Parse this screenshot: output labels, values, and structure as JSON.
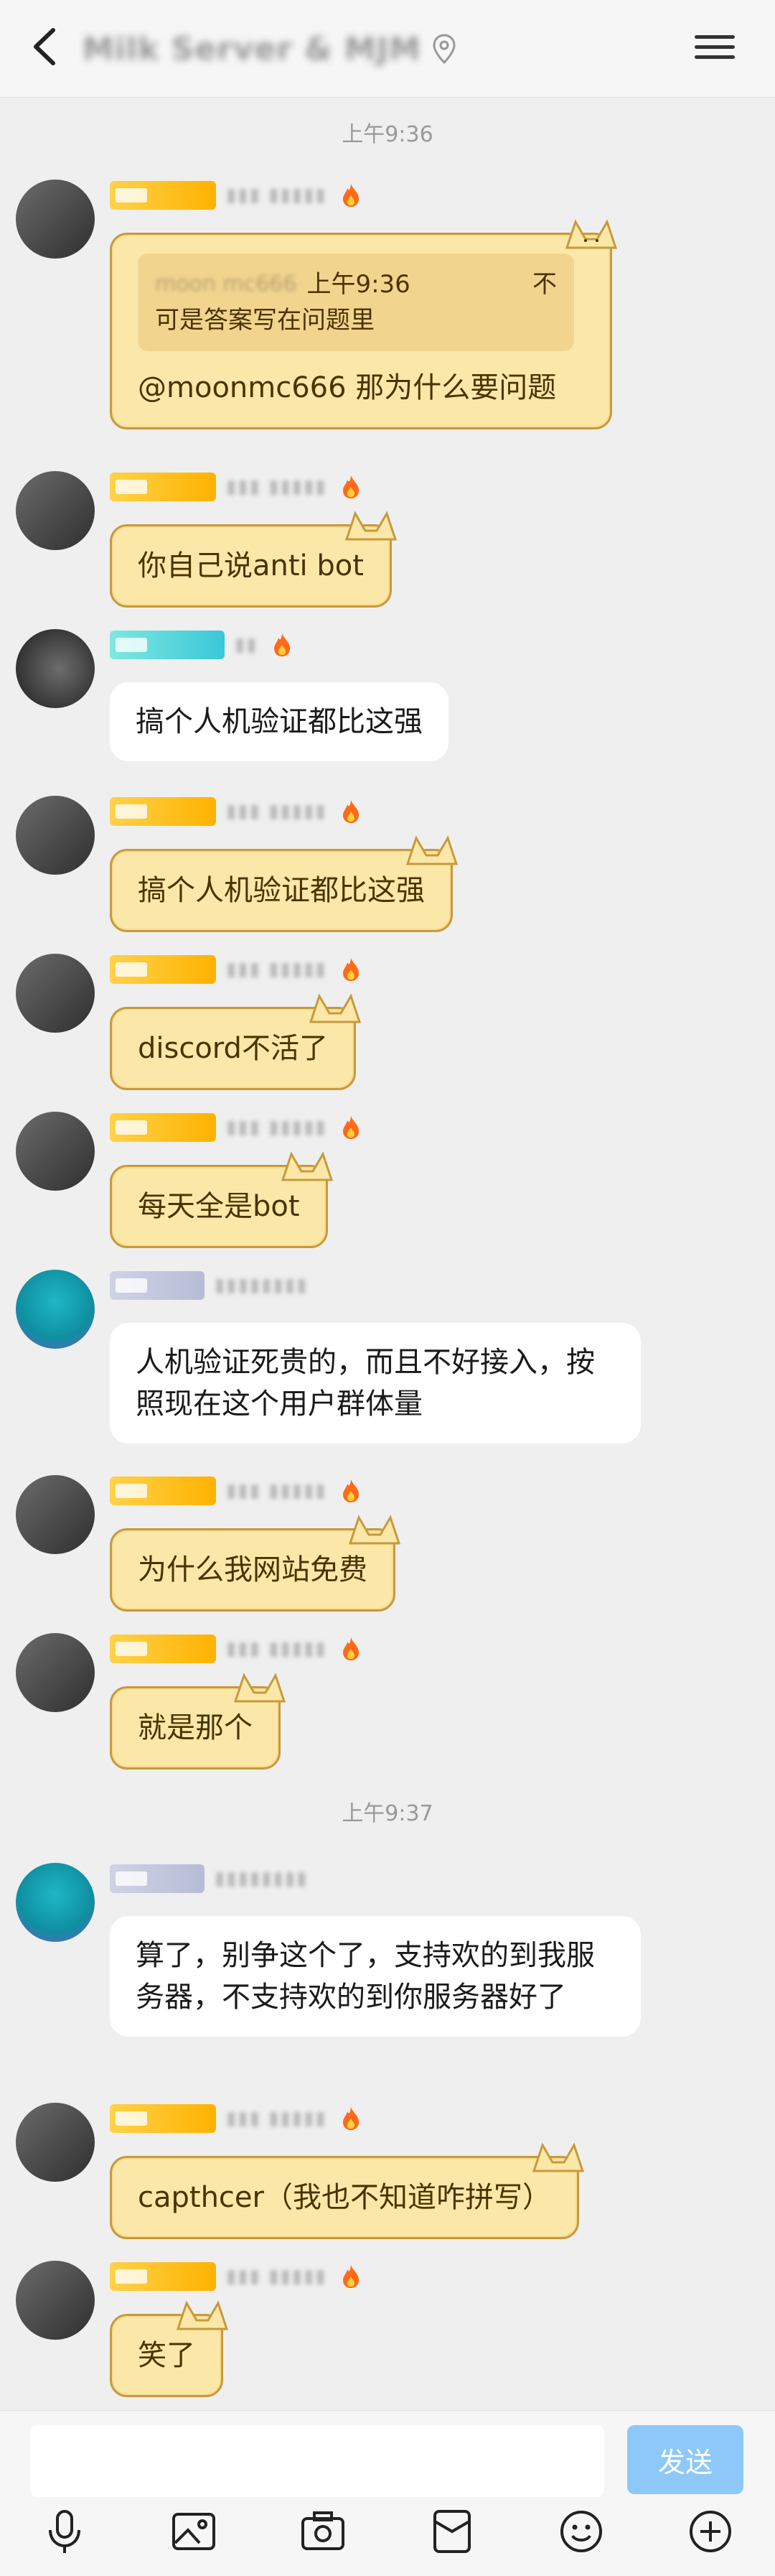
{
  "header": {
    "title": "Milk Server & MJM",
    "back_icon": "chevron-left-icon",
    "menu_icon": "hamburger-menu-icon"
  },
  "timestamps": [
    "上午9:36",
    "上午9:37"
  ],
  "messages": [
    {
      "kind": "yellow",
      "quote": {
        "name": "moon mc666",
        "time": "上午9:36",
        "more": "不",
        "text": "可是答案写在问题里"
      },
      "text": "@moonmc666 那为什么要问题"
    },
    {
      "kind": "yellow",
      "text": "你自己说anti bot"
    },
    {
      "kind": "white",
      "text": "搞个人机验证都比这强"
    },
    {
      "kind": "yellow",
      "text": "搞个人机验证都比这强"
    },
    {
      "kind": "yellow",
      "text": "discord不活了"
    },
    {
      "kind": "yellow",
      "text": "每天全是bot"
    },
    {
      "kind": "white",
      "text": "人机验证死贵的，而且不好接入，按照现在这个用户群体量"
    },
    {
      "kind": "yellow",
      "text": "为什么我网站免费"
    },
    {
      "kind": "yellow",
      "text": "就是那个"
    },
    {
      "kind": "white",
      "text": "算了，别争这个了，支持欢的到我服务器，不支持欢的到你服务器好了"
    },
    {
      "kind": "yellow",
      "text": "capthcer（我也不知道咋拼写）"
    },
    {
      "kind": "yellow",
      "text": "笑了"
    }
  ],
  "input": {
    "placeholder": "",
    "send_label": "发送"
  },
  "toolbar": {
    "icons": [
      "microphone-icon",
      "image-icon",
      "camera-icon",
      "red-packet-icon",
      "emoji-icon",
      "add-icon"
    ]
  },
  "colors": {
    "background": "#efefef",
    "yellow_bubble": "#fbe8a8",
    "white_bubble": "#ffffff",
    "send_button": "#8dc8f8"
  }
}
